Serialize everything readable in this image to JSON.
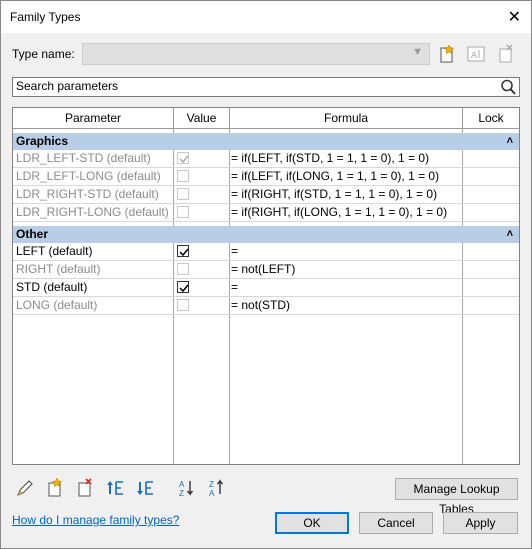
{
  "window": {
    "title": "Family Types"
  },
  "type_name": {
    "label": "Type name:",
    "value": ""
  },
  "search": {
    "placeholder": "Search parameters"
  },
  "columns": {
    "parameter": "Parameter",
    "value": "Value",
    "formula": "Formula",
    "lock": "Lock"
  },
  "groups": [
    {
      "name": "Graphics",
      "collapse_glyph": "˄"
    },
    {
      "name": "Other",
      "collapse_glyph": "˄"
    }
  ],
  "graphics_rows": [
    {
      "parameter": "LDR_LEFT-STD (default)",
      "checked": true,
      "formula": "= if(LEFT, if(STD, 1 = 1, 1 = 0), 1 = 0)"
    },
    {
      "parameter": "LDR_LEFT-LONG (default)",
      "checked": false,
      "formula": "= if(LEFT, if(LONG, 1 = 1, 1 = 0), 1 = 0)"
    },
    {
      "parameter": "LDR_RIGHT-STD (default)",
      "checked": false,
      "formula": "= if(RIGHT, if(STD, 1 = 1, 1 = 0), 1 = 0)"
    },
    {
      "parameter": "LDR_RIGHT-LONG (default)",
      "checked": false,
      "formula": "= if(RIGHT, if(LONG, 1 = 1, 1 = 0), 1 = 0)"
    }
  ],
  "other_rows": [
    {
      "parameter": "LEFT (default)",
      "checked": true,
      "formula": "="
    },
    {
      "parameter": "RIGHT (default)",
      "checked": false,
      "formula": "= not(LEFT)"
    },
    {
      "parameter": "STD (default)",
      "checked": true,
      "formula": "="
    },
    {
      "parameter": "LONG (default)",
      "checked": false,
      "formula": "= not(STD)"
    }
  ],
  "buttons": {
    "manage_lookup": "Manage Lookup Tables",
    "ok": "OK",
    "cancel": "Cancel",
    "apply": "Apply"
  },
  "help_link": "How do I manage family types?",
  "colors": {
    "group_header": "#b8cde6",
    "link": "#0066cc",
    "default_button_border": "#0078d7"
  }
}
